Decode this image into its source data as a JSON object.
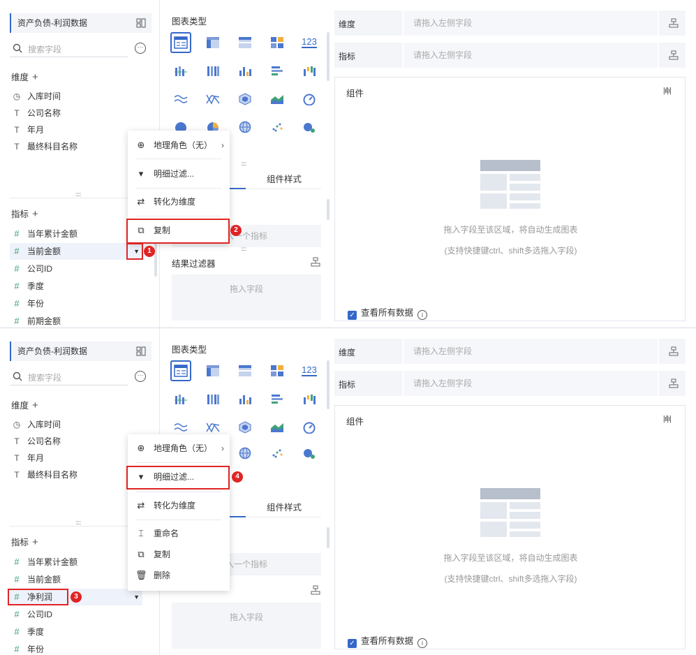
{
  "dataset_name": "资产负债-利润数据",
  "search_placeholder": "搜索字段",
  "dimension_label": "维度",
  "measure_label": "指标",
  "add_sign": "+",
  "dimensions": [
    {
      "icon": "clock-icon",
      "glyph": "◷",
      "label": "入库时间"
    },
    {
      "icon": "text-type-icon",
      "glyph": "T",
      "label": "公司名称"
    },
    {
      "icon": "text-type-icon",
      "glyph": "T",
      "label": "年月"
    },
    {
      "icon": "text-type-icon",
      "glyph": "T",
      "label": "最终科目名称"
    }
  ],
  "measures_panel1": [
    "当年累计金额",
    "当前金额",
    "公司ID",
    "季度",
    "年份",
    "前期金额"
  ],
  "measures_panel2": [
    "当年累计金额",
    "当前金额",
    "净利润",
    "公司ID",
    "季度",
    "年份"
  ],
  "hash_glyph": "#",
  "caret_glyph": "▼",
  "chart_type_title": "图表类型",
  "number_chart_label": "123",
  "tab_component_style": "组件样式",
  "drop_one_measure": "入一个指标",
  "result_filter_label": "结果过滤器",
  "drop_field": "拖入字段",
  "dimension_slot_label": "维度",
  "measure_slot_label": "指标",
  "slot_placeholder": "请拖入左侧字段",
  "component_label": "组件",
  "component_icon_text": "|ıl|ı|",
  "canvas_hint_1": "拖入字段至该区域，将自动生成图表",
  "canvas_hint_2": "(支持快捷键ctrl、shift多选拖入字段)",
  "view_all_data": "查看所有数据",
  "check_glyph": "✓",
  "info_glyph": "i",
  "menu1": [
    {
      "icon": "globe-icon",
      "glyph": "⊕",
      "label": "地理角色（无）",
      "arrow": "›"
    },
    {
      "icon": "filter-icon",
      "glyph": "▾",
      "label": "明细过滤..."
    },
    {
      "icon": "swap-icon",
      "glyph": "⇄",
      "label": "转化为维度"
    },
    {
      "icon": "copy-icon",
      "glyph": "⧉",
      "label": "复制"
    }
  ],
  "menu2": [
    {
      "icon": "globe-icon",
      "glyph": "⊕",
      "label": "地理角色（无）",
      "arrow": "›"
    },
    {
      "icon": "filter-icon",
      "glyph": "▾",
      "label": "明细过滤..."
    },
    {
      "icon": "swap-icon",
      "glyph": "⇄",
      "label": "转化为维度"
    },
    {
      "icon": "rename-icon",
      "glyph": "⌶",
      "label": "重命名"
    },
    {
      "icon": "copy-icon",
      "glyph": "⧉",
      "label": "复制"
    },
    {
      "icon": "trash-icon",
      "glyph": "🗑",
      "label": "删除"
    }
  ],
  "badges": [
    "1",
    "2",
    "3",
    "4"
  ],
  "colors": {
    "accent": "#3468c8",
    "annotation": "#e02424",
    "measure_hash": "#3fa278"
  }
}
